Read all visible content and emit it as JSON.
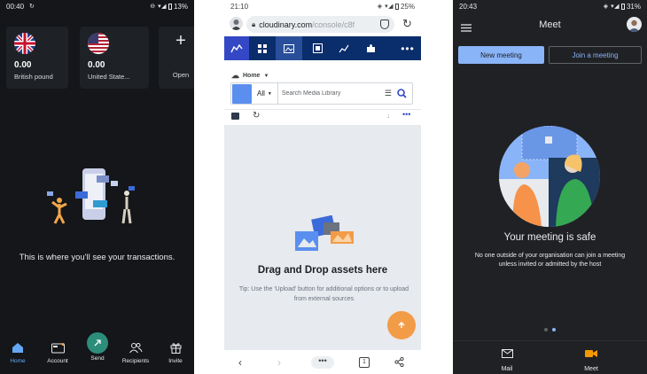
{
  "wise": {
    "status": {
      "time": "00:40",
      "battery": "13%"
    },
    "balances": [
      {
        "amount": "0.00",
        "currency": "British pound"
      },
      {
        "amount": "0.00",
        "currency": "United State..."
      }
    ],
    "open_label": "Open",
    "empty_message": "This is where you'll see your transactions.",
    "nav": [
      {
        "label": "Home"
      },
      {
        "label": "Account"
      },
      {
        "label": "Send"
      },
      {
        "label": "Recipients"
      },
      {
        "label": "Invite"
      }
    ],
    "colors": {
      "active": "#64a7f5",
      "send": "#2c8d7b",
      "card": "#1e2126"
    }
  },
  "cloudinary": {
    "status": {
      "time": "21:10",
      "battery": "25%"
    },
    "url": {
      "domain": "cloudinary.com",
      "path": "/console/c8f"
    },
    "breadcrumb": "Home",
    "filter": "All",
    "search_placeholder": "Search Media Library",
    "drop_title": "Drag and Drop assets here",
    "drop_tip": "Tip: Use the 'Upload' button for additional options or to upload from external sources",
    "tabs_count": "1",
    "colors": {
      "toolbar": "#0a2d6b",
      "accent": "#3448c5",
      "fab": "#f39c48"
    }
  },
  "meet": {
    "status": {
      "time": "20:43",
      "battery": "31%"
    },
    "title": "Meet",
    "new_meeting": "New meeting",
    "join_meeting": "Join a meeting",
    "safe_title": "Your meeting is safe",
    "safe_desc": "No one outside of your organisation can join a meeting unless invited or admitted by the host",
    "nav": [
      {
        "label": "Mail"
      },
      {
        "label": "Meet"
      }
    ],
    "colors": {
      "accent": "#8ab4f8",
      "background": "#202124"
    }
  }
}
